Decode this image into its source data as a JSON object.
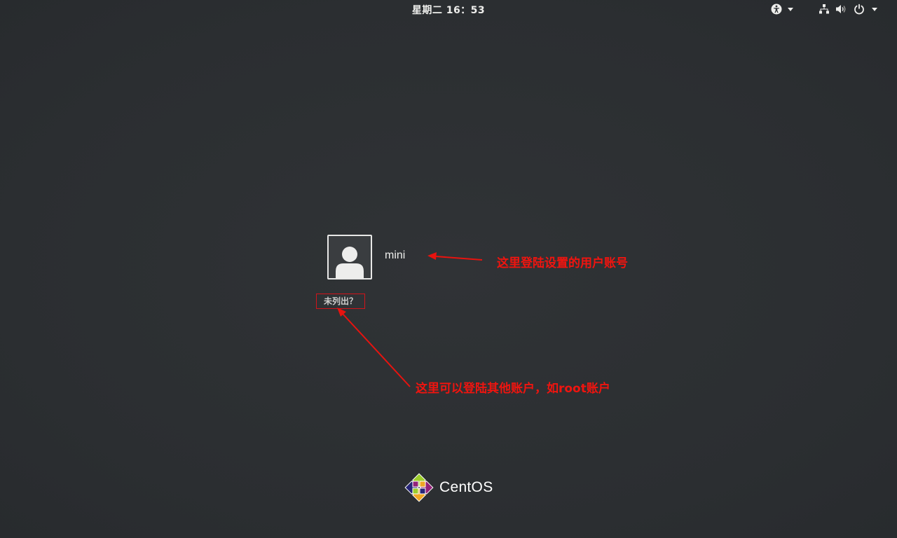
{
  "topbar": {
    "clock": "星期二 16：53",
    "icons": [
      "accessibility-icon",
      "network-icon",
      "volume-icon",
      "power-icon"
    ]
  },
  "login": {
    "user_name": "mini",
    "not_listed_label": "未列出？"
  },
  "annotations": {
    "user_account_note": "这里登陆设置的用户账号",
    "other_account_note": "这里可以登陆其他账户，如root账户"
  },
  "branding": {
    "logo_text": "CentOS"
  },
  "colors": {
    "background": "#2d3033",
    "annotation_red": "#f0140f",
    "text_light": "#eeeeec"
  }
}
